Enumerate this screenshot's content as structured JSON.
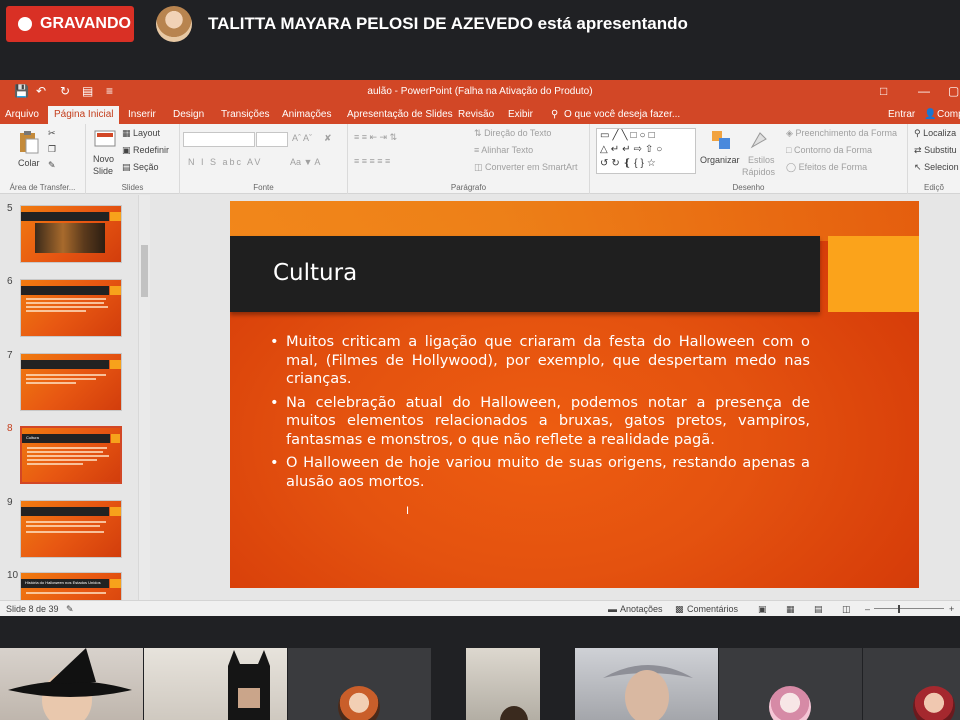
{
  "meet": {
    "recording_label": "GRAVANDO",
    "presenter_text": "TALITTA MAYARA PELOSI DE AZEVEDO está apresentando"
  },
  "ppt": {
    "window_title": "aulão - PowerPoint (Falha na Ativação do Produto)",
    "tabs": [
      {
        "label": "Arquivo"
      },
      {
        "label": "Página Inicial"
      },
      {
        "label": "Inserir"
      },
      {
        "label": "Design"
      },
      {
        "label": "Transições"
      },
      {
        "label": "Animações"
      },
      {
        "label": "Apresentação de Slides"
      },
      {
        "label": "Revisão"
      },
      {
        "label": "Exibir"
      },
      {
        "label": "O que você deseja fazer..."
      }
    ],
    "signin": "Entrar",
    "share": "Comp",
    "ribbon": {
      "clipboard": {
        "paste": "Colar",
        "label": "Área de Transfer..."
      },
      "slides": {
        "new": "Novo",
        "new2": "Slide",
        "layout": "Layout",
        "reset": "Redefinir",
        "section": "Seção",
        "label": "Slides"
      },
      "font": {
        "label": "Fonte",
        "buttons": "N  I  S  abc  AV"
      },
      "paragraph": {
        "text_dir": "Direção do Texto",
        "align_text": "Alinhar Texto",
        "smartart": "Converter em SmartArt",
        "label": "Parágrafo"
      },
      "drawing": {
        "arrange": "Organizar",
        "styles": "Estilos",
        "quick": "Rápidos",
        "fill": "Preenchimento da Forma",
        "outline": "Contorno da Forma",
        "effects": "Efeitos de Forma",
        "label": "Desenho"
      },
      "editing": {
        "find": "Localiza",
        "replace": "Substitu",
        "select": "Selecion",
        "label": "Ediçõ"
      }
    },
    "thumbnails": [
      {
        "num": "5"
      },
      {
        "num": "6"
      },
      {
        "num": "7"
      },
      {
        "num": "8",
        "title": "Cultura"
      },
      {
        "num": "9"
      },
      {
        "num": "10",
        "title": "História do Halloween nos Estados Unidos"
      }
    ],
    "slide": {
      "title": "Cultura",
      "bullets": [
        "Muitos criticam a ligação que criaram da festa do Halloween com o mal, (Filmes de Hollywood), por exemplo, que despertam medo nas crianças.",
        "Na celebração atual do Halloween, podemos notar a presença de muitos elementos relacionados a bruxas, gatos pretos, vampiros, fantasmas e monstros, o que não reflete a realidade pagã.",
        "O Halloween de hoje variou muito de suas origens, restando apenas a alusão aos mortos."
      ]
    },
    "status": {
      "slide_count": "Slide 8 de 39",
      "notes": "Anotações",
      "comments": "Comentários"
    }
  }
}
